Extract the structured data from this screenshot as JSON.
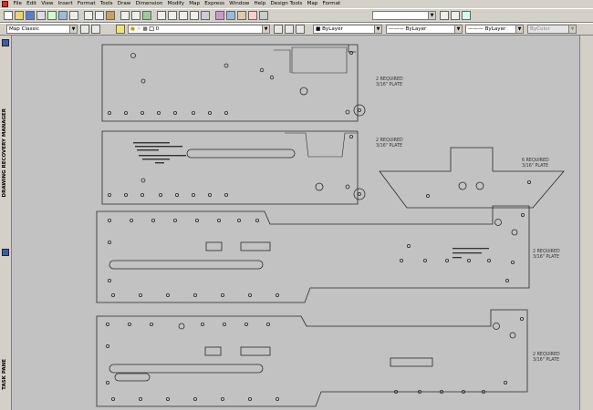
{
  "menu": [
    "File",
    "Edit",
    "View",
    "Insert",
    "Format",
    "Tools",
    "Draw",
    "Dimension",
    "Modify",
    "Map",
    "Express",
    "Window",
    "Help",
    "Design Tools",
    "Map",
    "Format"
  ],
  "toolbar": {
    "workspace": "Map Classic",
    "layer": "0",
    "color": "ByLayer",
    "linetype": "ByLayer",
    "lineweight": "ByLayer",
    "plotstyle": "ByColor"
  },
  "panels": {
    "drawing_recovery": "DRAWING RECOVERY MANAGER",
    "task_pane": "TASK PANE"
  },
  "drawing": {
    "labels": {
      "plate1": [
        "2 REQUIRED",
        "3/16\" PLATE"
      ],
      "plate2": [
        "2 REQUIRED",
        "3/16\" PLATE"
      ],
      "plate3": [
        "6 REQUIRED",
        "3/16\" PLATE"
      ],
      "plate4": [
        "2 REQUIRED",
        "3/16\" PLATE"
      ],
      "plate5": [
        "2 REQUIRED",
        "3/16\" PLATE"
      ]
    }
  },
  "colors": {
    "canvas_bg": "#c2c2c2",
    "linework": "#2a2a2a",
    "ui_bg": "#d4d0c8"
  }
}
